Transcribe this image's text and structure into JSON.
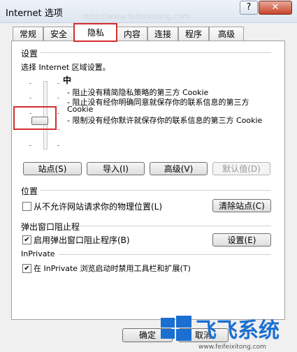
{
  "window": {
    "title": "Internet 选项",
    "help": "?",
    "close": "✕",
    "background_url": "http://www.feifeixitong.com"
  },
  "tabs": [
    {
      "label": "常规"
    },
    {
      "label": "安全"
    },
    {
      "label": "隐私"
    },
    {
      "label": "内容"
    },
    {
      "label": "连接"
    },
    {
      "label": "程序"
    },
    {
      "label": "高级"
    }
  ],
  "active_tab": "隐私",
  "settings": {
    "heading": "设置",
    "instruction": "选择 Internet 区域设置。",
    "level": "中",
    "slider_level_fraction": 0.5,
    "descriptions": [
      "- 阻止没有精简隐私策略的第三方 Cookie",
      "- 阻止没有经你明确同意就保存你的联系信息的第三方 Cookie",
      "- 限制没有经你默许就保存你的联系信息的第三方 Cookie"
    ],
    "buttons": {
      "sites": "站点(S)",
      "import": "导入(I)",
      "advanced": "高级(V)",
      "default": "默认值(D)"
    }
  },
  "location": {
    "heading": "位置",
    "checkbox_label": "从不允许网站请求你的物理位置(L)",
    "checked": false,
    "clear_button": "清除站点(C)"
  },
  "popup": {
    "heading": "弹出窗口阻止程",
    "checkbox_label": "启用弹出窗口阻止程序(B)",
    "checked": true,
    "settings_button": "设置(E)"
  },
  "inprivate": {
    "heading": "InPrivate",
    "checkbox_label": "在 InPrivate 浏览启动时禁用工具栏和扩展(T)",
    "checked": true
  },
  "footer": {
    "ok": "确定",
    "cancel": "取消"
  },
  "watermark": {
    "brand": "飞飞系统",
    "url": "www.feifeixitong.com"
  }
}
